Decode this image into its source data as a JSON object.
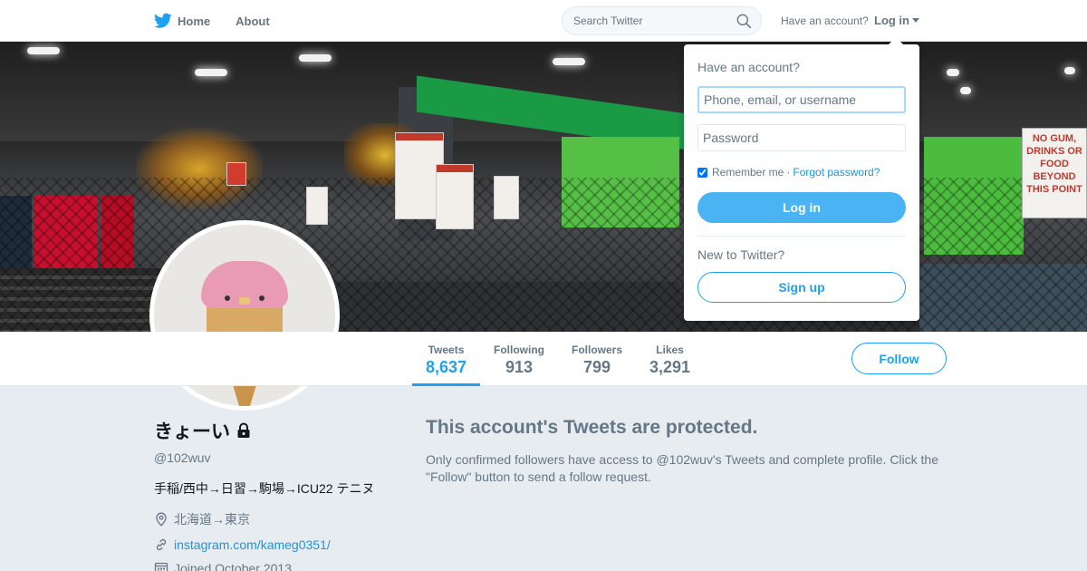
{
  "nav": {
    "home_label": "Home",
    "about_label": "About",
    "search_placeholder": "Search Twitter",
    "have_account": "Have an account?",
    "login_label": "Log in"
  },
  "profile": {
    "name": "きょーい",
    "handle": "@102wuv",
    "bio": "手稲/西中→日習→駒場→ICU22 テニヌ",
    "location": "北海道→東京",
    "website": "instagram.com/kameg0351/",
    "joined": "Joined October 2013"
  },
  "stats": [
    {
      "label": "Tweets",
      "value": "8,637"
    },
    {
      "label": "Following",
      "value": "913"
    },
    {
      "label": "Followers",
      "value": "799"
    },
    {
      "label": "Likes",
      "value": "3,291"
    }
  ],
  "follow_label": "Follow",
  "protected": {
    "title": "This account's Tweets are protected.",
    "message": "Only confirmed followers have access to @102wuv's Tweets and complete profile. Click the \"Follow\" button to send a follow request."
  },
  "login_dropdown": {
    "title": "Have an account?",
    "user_placeholder": "Phone, email, or username",
    "password_placeholder": "Password",
    "remember_label": "Remember me",
    "separator": "·",
    "forgot_label": "Forgot password?",
    "login_button": "Log in",
    "new_label": "New to Twitter?",
    "signup_button": "Sign up"
  },
  "banner_signs": {
    "right_sign": "NO GUM, DRINKS OR FOOD BEYOND THIS POINT"
  },
  "colors": {
    "brand": "#1da1f2",
    "login_button": "#4ab3f4",
    "link": "#1b95e0",
    "muted": "#657786",
    "background": "#e6ecf0"
  },
  "icons": {
    "logo": "twitter-bird-icon",
    "search": "search-icon",
    "lock": "lock-icon",
    "location": "location-pin-icon",
    "link": "link-icon",
    "calendar": "calendar-icon"
  }
}
